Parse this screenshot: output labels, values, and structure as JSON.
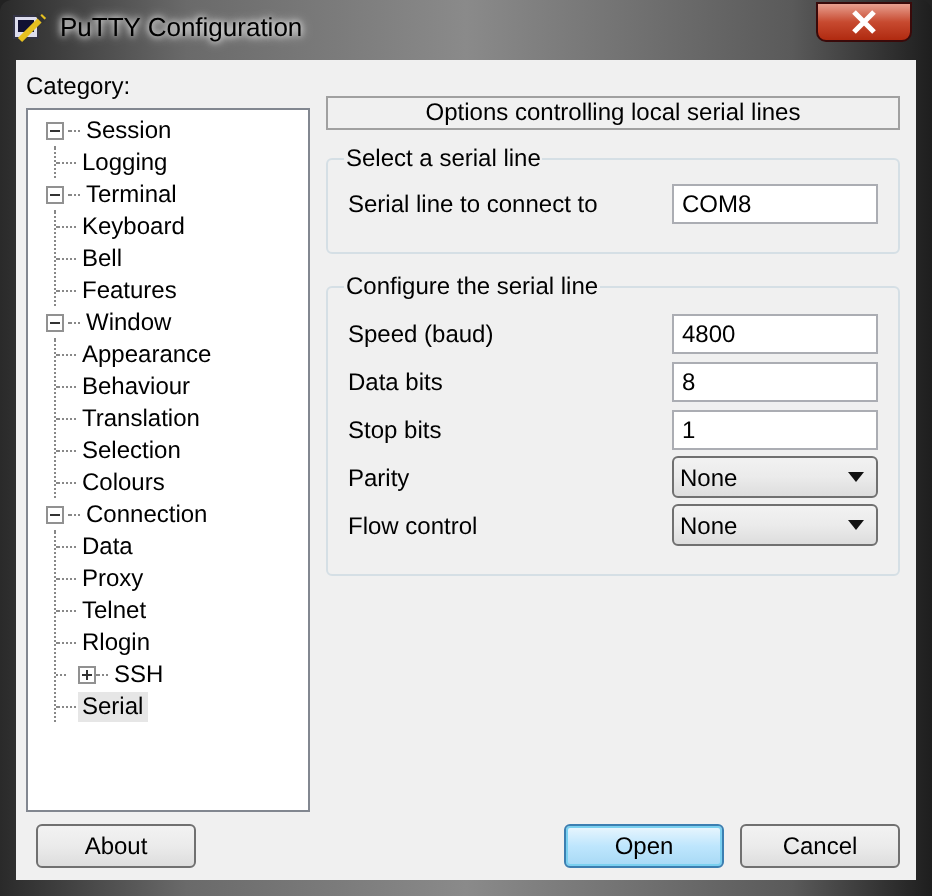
{
  "window": {
    "title": "PuTTY Configuration"
  },
  "category": {
    "label": "Category:",
    "tree": [
      {
        "label": "Session",
        "expanded": true,
        "selected": false,
        "children": [
          {
            "label": "Logging",
            "selected": false
          }
        ]
      },
      {
        "label": "Terminal",
        "expanded": true,
        "selected": false,
        "children": [
          {
            "label": "Keyboard",
            "selected": false
          },
          {
            "label": "Bell",
            "selected": false
          },
          {
            "label": "Features",
            "selected": false
          }
        ]
      },
      {
        "label": "Window",
        "expanded": true,
        "selected": false,
        "children": [
          {
            "label": "Appearance",
            "selected": false
          },
          {
            "label": "Behaviour",
            "selected": false
          },
          {
            "label": "Translation",
            "selected": false
          },
          {
            "label": "Selection",
            "selected": false
          },
          {
            "label": "Colours",
            "selected": false
          }
        ]
      },
      {
        "label": "Connection",
        "expanded": true,
        "selected": false,
        "children": [
          {
            "label": "Data",
            "selected": false
          },
          {
            "label": "Proxy",
            "selected": false
          },
          {
            "label": "Telnet",
            "selected": false
          },
          {
            "label": "Rlogin",
            "selected": false
          },
          {
            "label": "SSH",
            "expanded": false,
            "selected": false
          },
          {
            "label": "Serial",
            "selected": true
          }
        ]
      }
    ]
  },
  "panel": {
    "header": "Options controlling local serial lines",
    "groups": [
      {
        "title": "Select a serial line",
        "fields": [
          {
            "kind": "text",
            "label": "Serial line to connect to",
            "value": "COM8"
          }
        ]
      },
      {
        "title": "Configure the serial line",
        "fields": [
          {
            "kind": "text",
            "label": "Speed (baud)",
            "value": "4800"
          },
          {
            "kind": "text",
            "label": "Data bits",
            "value": "8"
          },
          {
            "kind": "text",
            "label": "Stop bits",
            "value": "1"
          },
          {
            "kind": "select",
            "label": "Parity",
            "value": "None"
          },
          {
            "kind": "select",
            "label": "Flow control",
            "value": "None"
          }
        ]
      }
    ]
  },
  "footer": {
    "left_buttons": [
      {
        "label": "About",
        "default": false
      }
    ],
    "right_buttons": [
      {
        "label": "Open",
        "default": true
      },
      {
        "label": "Cancel",
        "default": false
      }
    ]
  }
}
